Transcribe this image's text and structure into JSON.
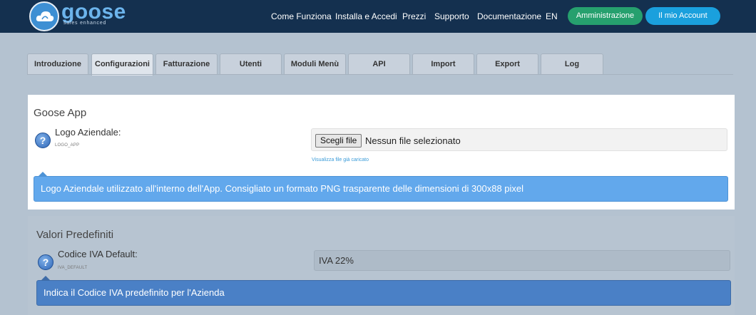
{
  "header": {
    "logo_text": "goose",
    "logo_sub": "sales enhanced",
    "nav": [
      "Come Funziona",
      "Installa e Accedi",
      "Prezzi",
      "Supporto",
      "Documentazione",
      "EN"
    ],
    "admin_label": "Amministrazione",
    "account_label": "Il mio Account"
  },
  "tabs": [
    "Introduzione",
    "Configurazioni",
    "Fatturazione",
    "Utenti",
    "Moduli Menù",
    "API",
    "Import",
    "Export",
    "Log"
  ],
  "active_tab": "Configurazioni",
  "section_app": {
    "title": "Goose App",
    "field_label": "Logo Aziendale:",
    "field_code": "LOGO_APP",
    "file_button": "Scegli file",
    "file_status": "Nessun file selezionato",
    "view_link": "Visualizza file già caricato",
    "info": "Logo Aziendale utilizzato all'interno dell'App. Consigliato un formato PNG trasparente delle dimensioni di 300x88 pixel"
  },
  "section_defaults": {
    "title": "Valori Predefiniti",
    "field_label": "Codice IVA Default:",
    "field_code": "IVA_DEFAULT",
    "value": "IVA 22%",
    "info": "Indica il Codice IVA predefinito per l'Azienda"
  },
  "help_glyph": "?",
  "colors": {
    "header_bg": "#14304f",
    "admin_btn": "#26a06e",
    "account_btn": "#1aa0dd",
    "info_light": "#62a8ec",
    "info_dark": "#4a80c6"
  }
}
